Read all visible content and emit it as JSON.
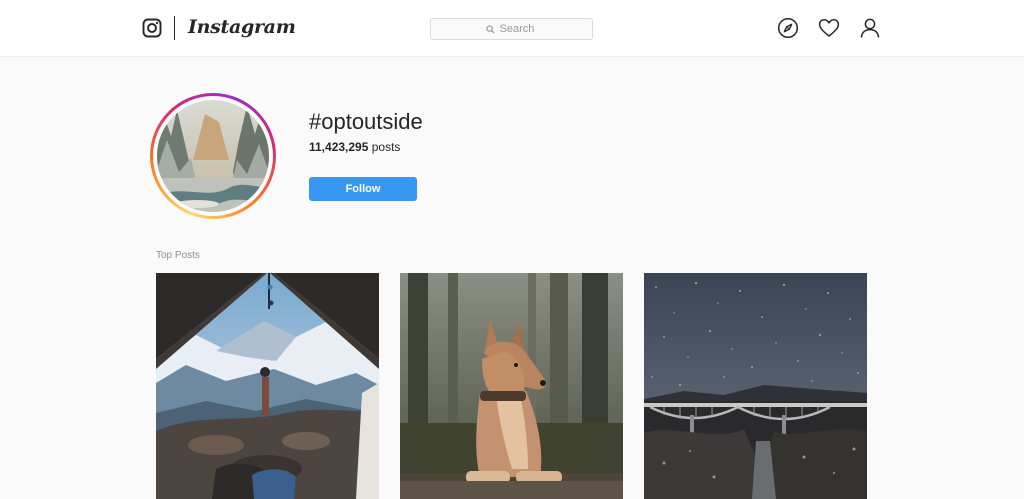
{
  "header": {
    "brand": "Instagram",
    "search_placeholder": "Search",
    "icons": [
      "instagram-camera-icon",
      "search-icon",
      "explore-compass-icon",
      "heart-icon",
      "profile-person-icon"
    ]
  },
  "hashtag": {
    "title": "#optoutside",
    "posts_number": "11,423,295",
    "posts_suffix": " posts",
    "follow_label": "Follow"
  },
  "top_posts": {
    "label": "Top Posts",
    "items": [
      {
        "subject": "view from tent of snowy mountain range"
      },
      {
        "subject": "dog sitting in forest"
      },
      {
        "subject": "starry night sky over bridge"
      }
    ]
  },
  "colors": {
    "accent": "#3897f0",
    "text": "#262626",
    "muted": "#8e8e8e",
    "background": "#fafafa"
  }
}
